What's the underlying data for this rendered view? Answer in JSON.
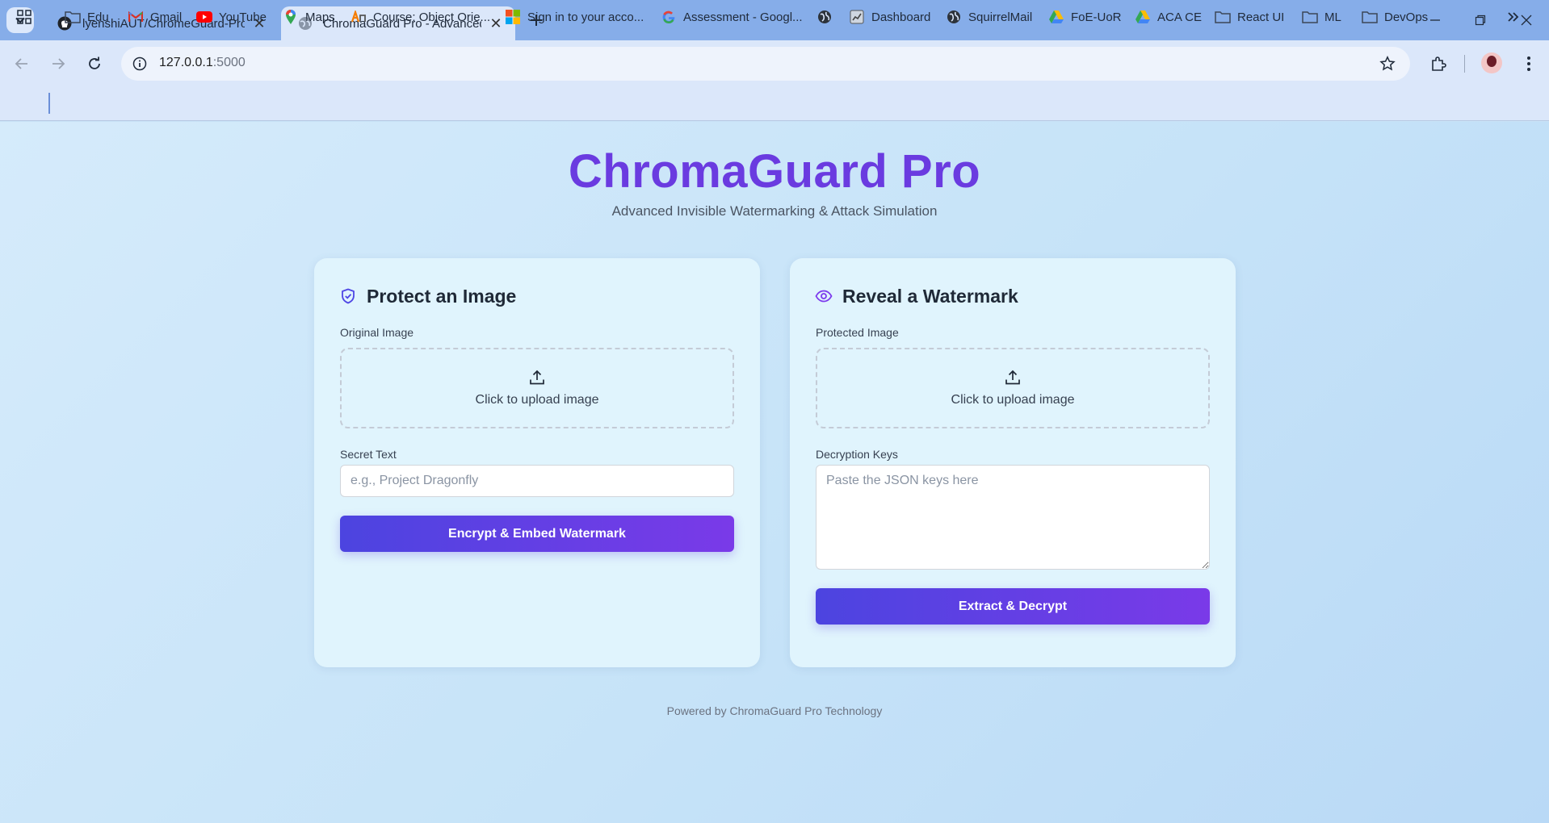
{
  "browser": {
    "tabs": [
      {
        "title": "lyenshiAUT/ChromeGuard-Pro",
        "icon": "github-icon",
        "active": false
      },
      {
        "title": "ChromaGuard Pro - Advanced Invisible Watermarking",
        "icon": "globe-icon",
        "active": true
      }
    ],
    "url_host": "127.0.0.1",
    "url_port": ":5000"
  },
  "bookmarks": [
    {
      "label": "Edu",
      "icon": "folder-icon"
    },
    {
      "label": "Gmail",
      "icon": "gmail-icon"
    },
    {
      "label": "YouTube",
      "icon": "youtube-icon"
    },
    {
      "label": "Maps",
      "icon": "maps-icon"
    },
    {
      "label": "Course: Object Orie...",
      "icon": "course-icon"
    },
    {
      "label": "Sign in to your acco...",
      "icon": "microsoft-icon"
    },
    {
      "label": "Assessment - Googl...",
      "icon": "google-icon"
    },
    {
      "label": "",
      "icon": "globe-icon"
    },
    {
      "label": "Dashboard",
      "icon": "dashboard-icon"
    },
    {
      "label": "SquirrelMail",
      "icon": "globe-icon"
    },
    {
      "label": "FoE-UoR",
      "icon": "drive-icon"
    },
    {
      "label": "ACA CE",
      "icon": "drive-icon"
    },
    {
      "label": "React UI",
      "icon": "folder-icon"
    },
    {
      "label": "ML",
      "icon": "folder-icon"
    },
    {
      "label": "DevOps",
      "icon": "folder-icon"
    }
  ],
  "header": {
    "title": "ChromaGuard Pro",
    "subtitle": "Advanced Invisible Watermarking & Attack Simulation"
  },
  "protect": {
    "title": "Protect an Image",
    "icon": "shield-check-icon",
    "image_label": "Original Image",
    "upload_text": "Click to upload image",
    "secret_label": "Secret Text",
    "secret_placeholder": "e.g., Project Dragonfly",
    "button": "Encrypt & Embed Watermark"
  },
  "reveal": {
    "title": "Reveal a Watermark",
    "icon": "eye-icon",
    "image_label": "Protected Image",
    "upload_text": "Click to upload image",
    "keys_label": "Decryption Keys",
    "keys_placeholder": "Paste the JSON keys here",
    "button": "Extract & Decrypt"
  },
  "footer": "Powered by ChromaGuard Pro Technology",
  "colors": {
    "accent": "#6a3be0",
    "button_start": "#4c44e0",
    "button_end": "#7a3ae8",
    "card_bg": "#e0f4fd"
  }
}
